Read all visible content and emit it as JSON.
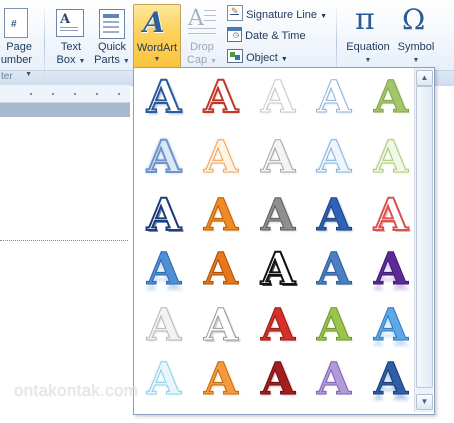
{
  "ribbon": {
    "page_number": {
      "line1": "Page",
      "line2": "umber"
    },
    "text_box": {
      "line1": "Text",
      "line2": "Box"
    },
    "quick_parts": {
      "line1": "Quick",
      "line2": "Parts"
    },
    "wordart": {
      "label": "WordArt"
    },
    "drop_cap": {
      "line1": "Drop",
      "line2": "Cap"
    },
    "signature_line": "Signature Line",
    "date_time": "Date & Time",
    "object": "Object",
    "equation": "Equation",
    "symbol": "Symbol",
    "group_label_left": "ter",
    "equation_icon": "π",
    "symbol_icon": "Ω"
  },
  "gallery": {
    "glyph": "A",
    "styles": [
      [
        "blue-outline-bevel",
        "red-outline",
        "white-outline",
        "light-blue-outline",
        "green-gradient"
      ],
      [
        "blue-glow",
        "orange-outline",
        "gray-outline",
        "light-blue-glow",
        "light-green-outline"
      ],
      [
        "navy-outline",
        "orange-bevel",
        "silver-gradient",
        "blue-gradient",
        "red-double-outline"
      ],
      [
        "blue-reflection",
        "orange-solid",
        "black-white-outline",
        "steel-blue",
        "purple-reflection"
      ],
      [
        "silver-light",
        "gray-outline-light",
        "red-gradient",
        "green-gradient-2",
        "blue-reflection-2"
      ],
      [
        "light-cyan",
        "orange-gradient",
        "dark-red",
        "lavender",
        "blue-steel-reflection"
      ]
    ]
  },
  "watermark": "ontakontak.com"
}
